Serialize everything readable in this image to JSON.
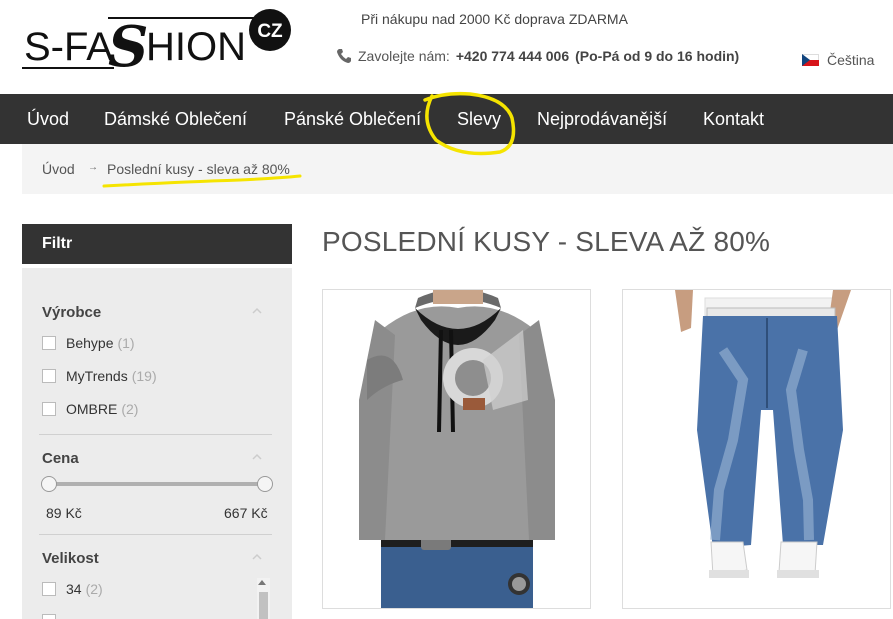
{
  "brand": {
    "logo_text": "S-FASHION",
    "logo_badge": "CZ"
  },
  "header": {
    "promo": "Při nákupu nad 2000 Kč doprava ZDARMA",
    "phone_prefix": "Zavolejte nám:",
    "phone_number": "+420 774 444 006",
    "phone_hours": "(Po-Pá od 9 do 16 hodin)",
    "language": "Čeština"
  },
  "nav": {
    "items": [
      {
        "label": "Úvod"
      },
      {
        "label": "Dámské Oblečení"
      },
      {
        "label": "Pánské Oblečení"
      },
      {
        "label": "Slevy"
      },
      {
        "label": "Nejprodávanější"
      },
      {
        "label": "Kontakt"
      }
    ]
  },
  "breadcrumb": {
    "home": "Úvod",
    "separator": "→",
    "current": "Poslední kusy - sleva až 80%"
  },
  "filter": {
    "title": "Filtr",
    "manufacturer": {
      "title": "Výrobce",
      "options": [
        {
          "label": "Behype",
          "count": "(1)"
        },
        {
          "label": "MyTrends",
          "count": "(19)"
        },
        {
          "label": "OMBRE",
          "count": "(2)"
        }
      ]
    },
    "price": {
      "title": "Cena",
      "min": "89 Kč",
      "max": "667 Kč"
    },
    "size": {
      "title": "Velikost",
      "options": [
        {
          "label": "34",
          "count": "(2)"
        }
      ]
    }
  },
  "main": {
    "title": "POSLEDNÍ KUSY - SLEVA AŽ 80%"
  },
  "colors": {
    "nav_bg": "#333333",
    "annotation": "#f5e400"
  }
}
